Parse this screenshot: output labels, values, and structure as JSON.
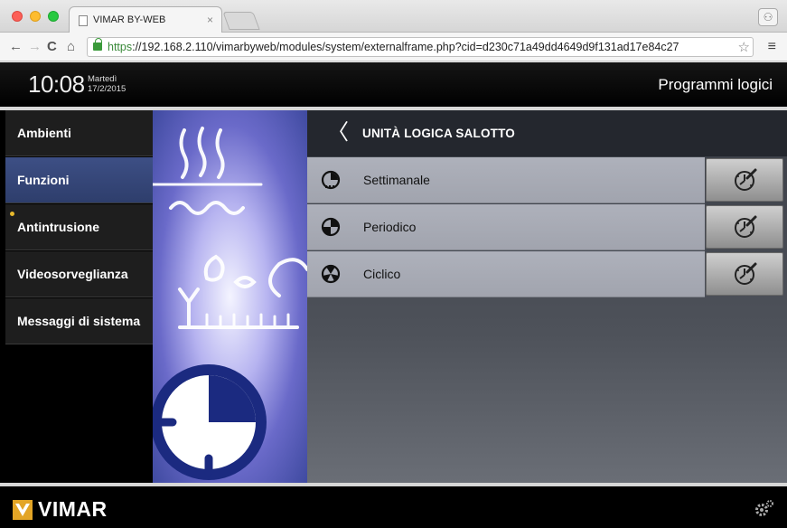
{
  "browser": {
    "tab_title": "VIMAR BY-WEB",
    "tab_close": "×",
    "url_scheme": "https",
    "url_rest": "://192.168.2.110/vimarbyweb/modules/system/externalframe.php?cid=d230c71a49dd4649d9f131ad17e84c27",
    "nav_back": "←",
    "nav_forward": "→",
    "nav_reload": "C",
    "nav_home": "⌂",
    "star": "☆",
    "menu": "≡",
    "profile": "⚇"
  },
  "header": {
    "time": "10:08",
    "day": "Martedì",
    "date": "17/2/2015",
    "title": "Programmi logici"
  },
  "sidebar": {
    "items": [
      {
        "label": "Ambienti",
        "active": false
      },
      {
        "label": "Funzioni",
        "active": true
      },
      {
        "label": "Antintrusione",
        "active": false,
        "alert_dot": true
      },
      {
        "label": "Videosorveglianza",
        "active": false
      },
      {
        "label": "Messaggi di sistema",
        "active": false
      }
    ],
    "alert_color": "#e7b92c"
  },
  "main": {
    "back": "〈",
    "title": "UNITÀ LOGICA SALOTTO",
    "rows": [
      {
        "label": "Settimanale",
        "icon": "weekly-program-icon"
      },
      {
        "label": "Periodico",
        "icon": "periodic-program-icon"
      },
      {
        "label": "Ciclico",
        "icon": "cyclic-program-icon"
      }
    ],
    "edit_icon": "clock-edit-icon"
  },
  "footer": {
    "brand": "VIMAR",
    "settings_icon": "gear-icon"
  },
  "colors": {
    "active_nav": "#3d4f85",
    "row_bg": "#aeb1bb",
    "header_bg": "#24272e"
  }
}
